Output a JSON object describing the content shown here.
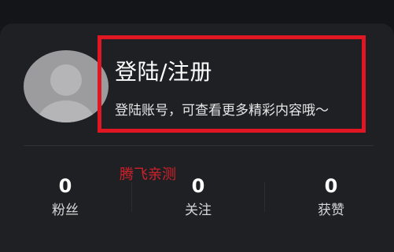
{
  "profile": {
    "login_title": "登陆/注册",
    "login_subtitle": "登陆账号，可查看更多精彩内容哦～",
    "avatar_icon": "default-avatar-icon"
  },
  "watermark": "腾飞亲测",
  "stats": [
    {
      "count": "0",
      "label": "粉丝"
    },
    {
      "count": "0",
      "label": "关注"
    },
    {
      "count": "0",
      "label": "获赞"
    }
  ],
  "colors": {
    "background": "#141518",
    "card": "#1f2024",
    "highlight_box": "#e01722",
    "watermark": "#d0202a",
    "avatar": "#9c9c9f"
  }
}
